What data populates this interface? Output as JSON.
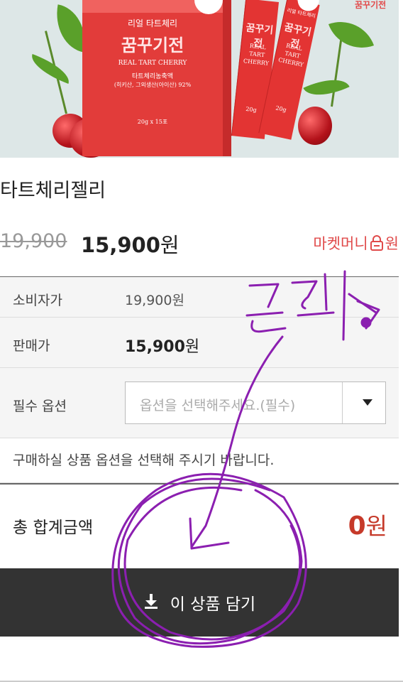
{
  "product_image": {
    "box_line1": "리얼 타트체리",
    "box_line2": "꿈꾸기전",
    "box_line3": "REAL TART CHERRY",
    "box_line4": "타트체리농축액",
    "box_line5": "(히키산, 그외생산(아이산) 92%",
    "box_weight": "20g x 15포",
    "stick1_brand": "꿈꾸기전",
    "stick1_text": "REAL\nTART\nCHERRY",
    "stick1_weight": "20g",
    "stick2_top": "리얼 타트체리",
    "stick2_brand": "꿈꾸기전",
    "stick2_text": "REAL\nTART\nCHERRY",
    "stick2_weight": "20g",
    "corner_text": "꿈꾸기전"
  },
  "product": {
    "name": "타트체리젤리",
    "original_price": "19,900",
    "sale_price": "15,900",
    "sale_unit": "원",
    "market_money": "마켓머니",
    "market_money_unit": "원"
  },
  "details": {
    "consumer_price_label": "소비자가",
    "consumer_price_value": "19,900원",
    "sale_price_label": "판매가",
    "sale_price_value": "15,900",
    "sale_price_unit": "원",
    "required_option_label": "필수 옵션",
    "option_placeholder": "옵션을 선택해주세요.(필수)",
    "notice": "구매하실 상품 옵션을 선택해 주시기 바랍니다."
  },
  "total": {
    "label": "총 합계금액",
    "amount": "0",
    "unit": "원"
  },
  "cart_button": {
    "label": "이 상품 담기",
    "icon": "download-icon"
  },
  "annotation": {
    "handwritten_text": "클릭"
  },
  "colors": {
    "accent_red": "#c63a2a",
    "market_money_red": "#e04a4a",
    "cart_button_bg": "#333333",
    "annotation_purple": "#8b1fb0"
  }
}
